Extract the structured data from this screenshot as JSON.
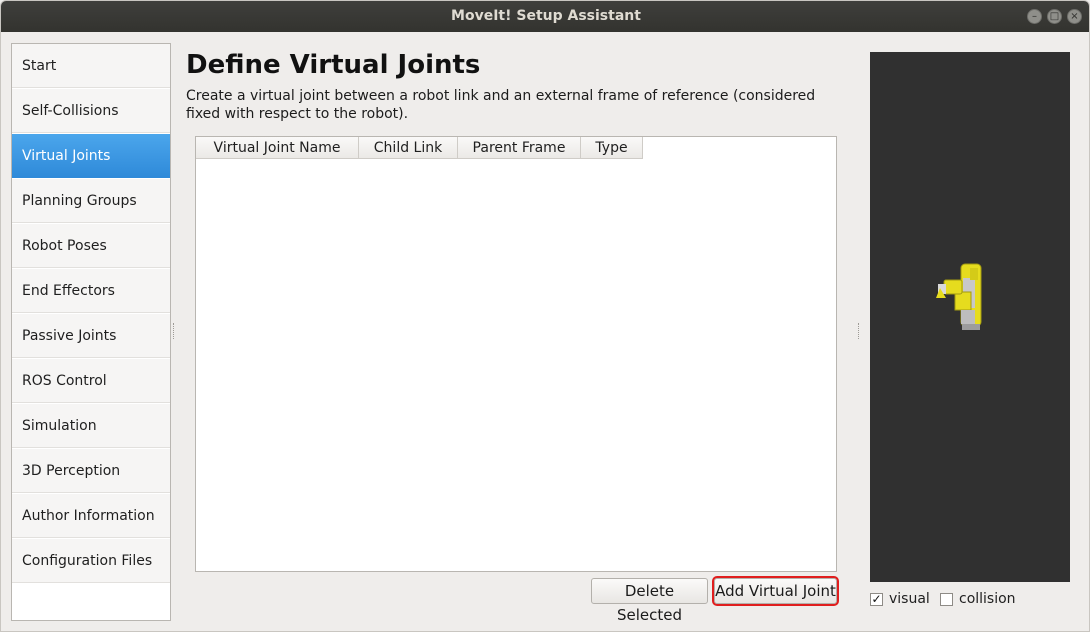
{
  "window": {
    "title": "MoveIt! Setup Assistant"
  },
  "sidebar": {
    "items": [
      {
        "label": "Start"
      },
      {
        "label": "Self-Collisions"
      },
      {
        "label": "Virtual Joints"
      },
      {
        "label": "Planning Groups"
      },
      {
        "label": "Robot Poses"
      },
      {
        "label": "End Effectors"
      },
      {
        "label": "Passive Joints"
      },
      {
        "label": "ROS Control"
      },
      {
        "label": "Simulation"
      },
      {
        "label": "3D Perception"
      },
      {
        "label": "Author Information"
      },
      {
        "label": "Configuration Files"
      }
    ],
    "active_index": 2
  },
  "main": {
    "heading": "Define Virtual Joints",
    "description": "Create a virtual joint between a robot link and an external frame of reference (considered fixed with respect to the robot).",
    "table": {
      "columns": [
        "Virtual Joint Name",
        "Child Link",
        "Parent Frame",
        "Type"
      ],
      "rows": []
    },
    "buttons": {
      "delete_label": "Delete Selected",
      "add_label": "Add Virtual Joint"
    }
  },
  "viewer": {
    "visual_label": "visual",
    "visual_checked": true,
    "collision_label": "collision",
    "collision_checked": false,
    "background_color": "#303030",
    "robot_color": "#e8e020"
  },
  "colors": {
    "accent": "#3a96e2",
    "highlight_border": "#e01e1e"
  }
}
